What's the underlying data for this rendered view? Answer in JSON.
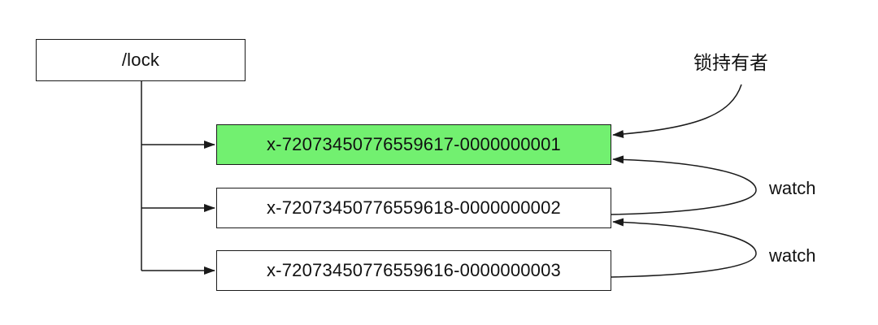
{
  "root": {
    "label": "/lock"
  },
  "nodes": [
    {
      "label": "x-72073450776559617-0000000001",
      "lock_holder": true
    },
    {
      "label": "x-72073450776559618-0000000002",
      "lock_holder": false
    },
    {
      "label": "x-72073450776559616-0000000003",
      "lock_holder": false
    }
  ],
  "annotations": {
    "holder_label": "锁持有者",
    "watch_label_1": "watch",
    "watch_label_2": "watch"
  },
  "colors": {
    "holder_fill": "#72f070",
    "stroke": "#1a1a1a"
  }
}
